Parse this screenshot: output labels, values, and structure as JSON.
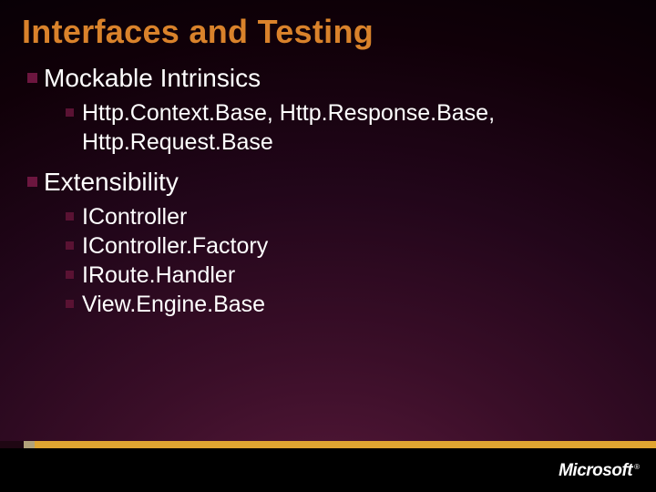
{
  "slide": {
    "title": "Interfaces and Testing",
    "items": [
      {
        "label": "Mockable Intrinsics",
        "children": [
          {
            "label": "Http.Context.Base, Http.Response.Base, Http.Request.Base"
          }
        ]
      },
      {
        "label": "Extensibility",
        "children": [
          {
            "label": "IController"
          },
          {
            "label": "IController.Factory"
          },
          {
            "label": "IRoute.Handler"
          },
          {
            "label": "View.Engine.Base"
          }
        ]
      }
    ]
  },
  "footer": {
    "brand": "Microsoft",
    "trademark": "®"
  },
  "colors": {
    "title": "#d9822b",
    "bullet": "#6c163f",
    "accent_gold": "#e0a531"
  }
}
